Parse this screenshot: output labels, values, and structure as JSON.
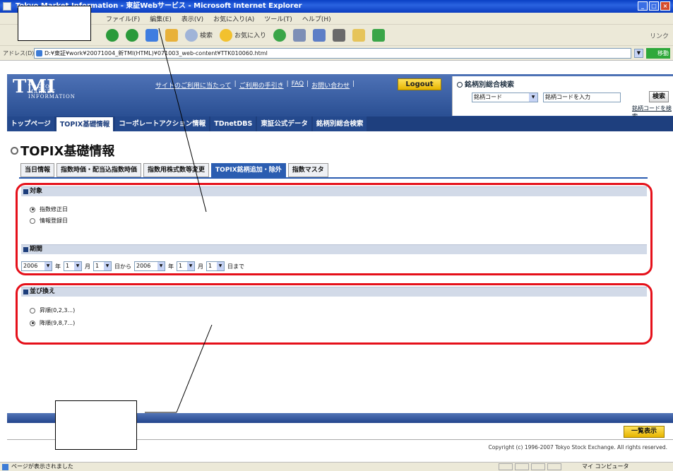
{
  "browser": {
    "title": "Tokyo Market Information - 東証Webサービス - Microsoft Internet Explorer",
    "menu": [
      "ファイル(F)",
      "編集(E)",
      "表示(V)",
      "お気に入り(A)",
      "ツール(T)",
      "ヘルプ(H)"
    ],
    "toolbar": {
      "search_label": "検索",
      "favorites_label": "お気に入り",
      "links_label": "リンク"
    },
    "address_label": "アドレス(D)",
    "address": "D:¥東証¥work¥20071004_新TMI(HTML)¥071003_web-content¥TTK010060.html",
    "go_label": "移動",
    "status_text": "ページが表示されました",
    "zone_text": "マイ コンピュータ"
  },
  "header": {
    "logo_big": "TMI",
    "logo_small": "TOKYO MARKET INFORMATION",
    "util_links": [
      "サイトのご利用に当たって",
      "ご利用の手引き",
      "FAQ",
      "お問い合わせ"
    ],
    "logout_label": "Logout"
  },
  "search": {
    "title": "銘柄別総合検索",
    "select_value": "銘柄コード",
    "input_placeholder": "銘柄コードを入力",
    "button_label": "検索",
    "code_link": "銘柄コードを検索"
  },
  "nav": [
    "トップページ",
    "TOPIX基礎情報",
    "コーポレートアクション情報",
    "TDnetDBS",
    "東証公式データ",
    "銘柄別総合検索"
  ],
  "page": {
    "title": "TOPIX基礎情報",
    "tabs": [
      "当日情報",
      "指数時価・配当込指数時価",
      "指数用株式数等変更",
      "TOPIX銘柄追加・除外",
      "指数マスタ"
    ],
    "target": {
      "heading": "対象",
      "options": [
        {
          "label": "指数修正日",
          "checked": true
        },
        {
          "label": "情報登録日",
          "checked": false
        }
      ]
    },
    "period": {
      "heading": "期間",
      "from_year": "2006",
      "from_month": "1",
      "from_day": "1",
      "to_year": "2006",
      "to_month": "1",
      "to_day": "1",
      "year_unit": "年",
      "month_unit": "月",
      "from_suffix": "日から",
      "to_suffix": "日まで"
    },
    "sort": {
      "heading": "並び換え",
      "options": [
        {
          "label": "昇順(0,2,3...)",
          "checked": false
        },
        {
          "label": "降順(9,8,7...)",
          "checked": true
        }
      ]
    },
    "list_button": "一覧表示",
    "copyright": "Copyright (c) 1996-2007 Tokyo Stock Exchange. All rights reserved."
  },
  "colors": {
    "annotation": "#e5101a",
    "nav": "#1e3f7e",
    "accent_button": "#f0c400"
  }
}
